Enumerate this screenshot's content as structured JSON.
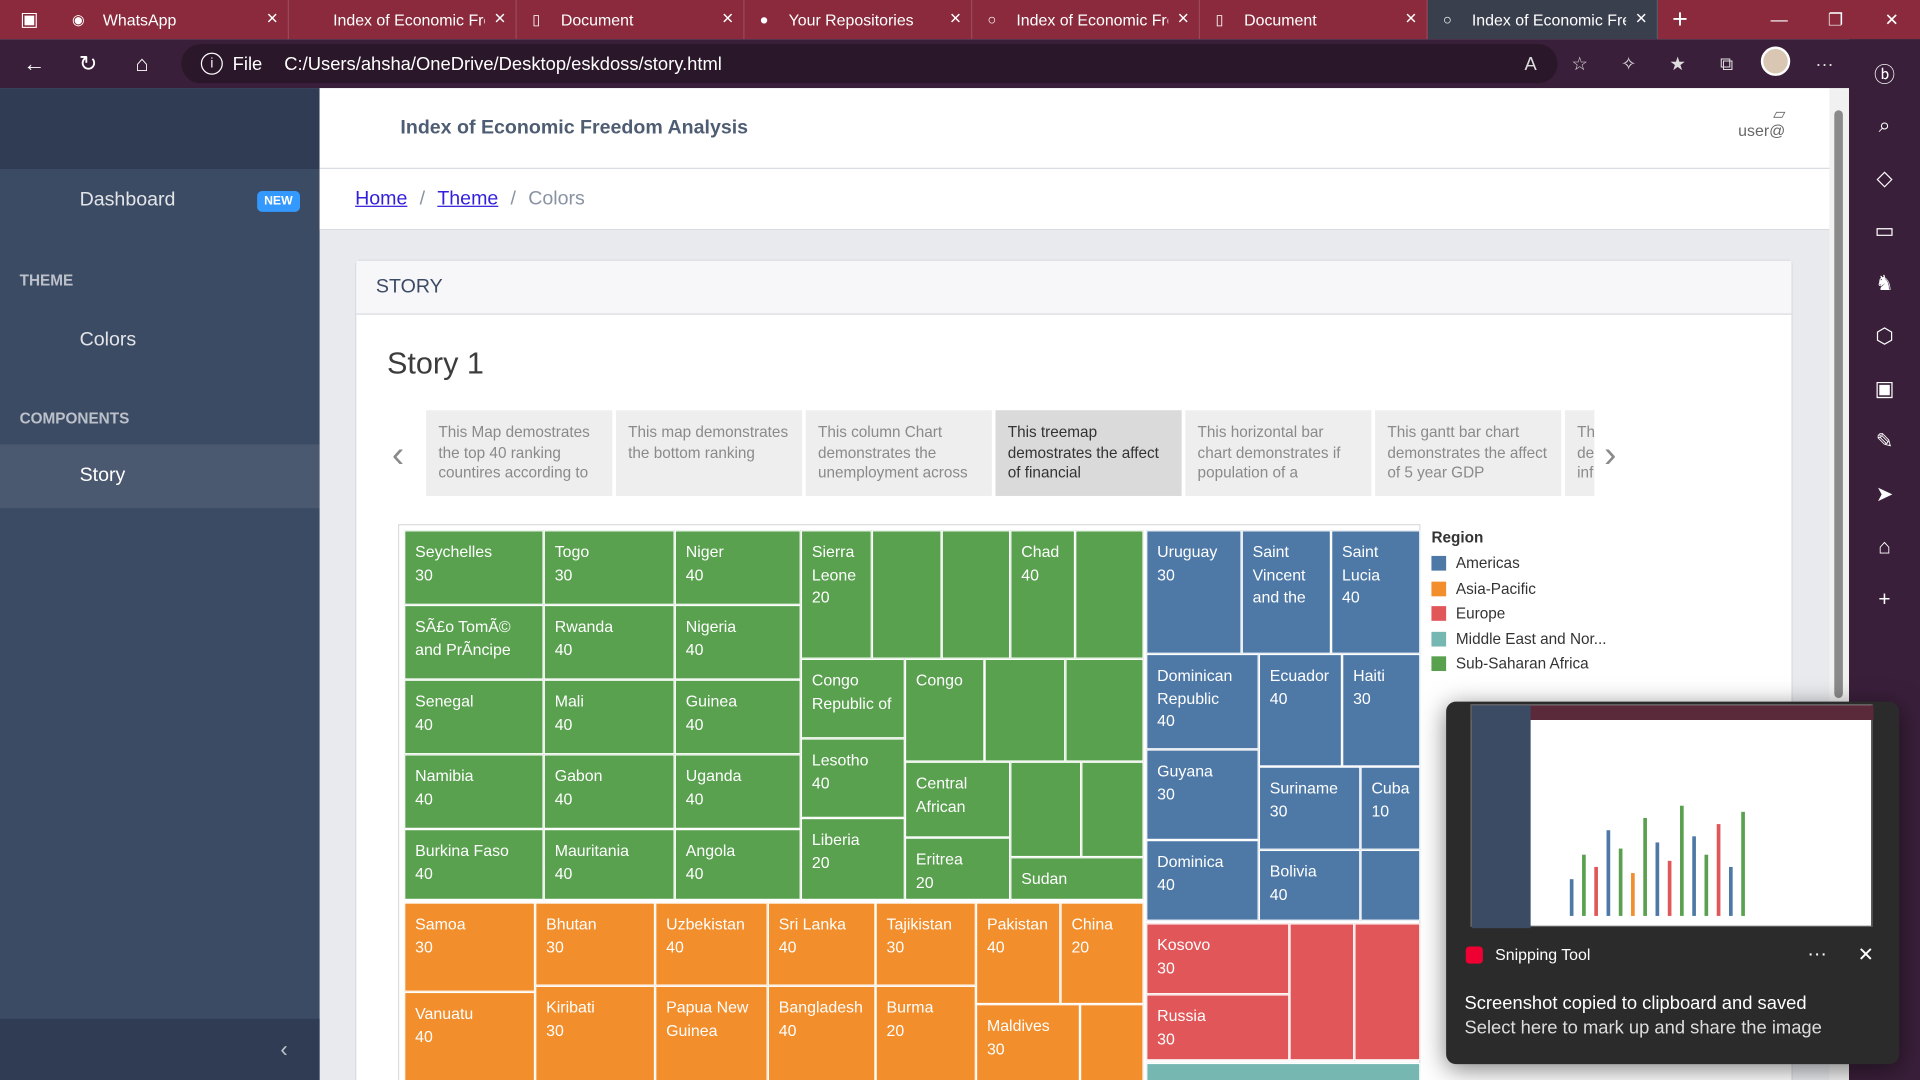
{
  "browser": {
    "tabs": [
      {
        "label": "WhatsApp",
        "icon": "whatsapp-icon"
      },
      {
        "label": "Index of Economic Fre",
        "icon": "page-icon"
      },
      {
        "label": "Document",
        "icon": "document-icon"
      },
      {
        "label": "Your Repositories",
        "icon": "github-icon"
      },
      {
        "label": "Index of Economic Fre",
        "icon": "page-icon"
      },
      {
        "label": "Document",
        "icon": "document-icon"
      },
      {
        "label": "Index of Economic Fre",
        "icon": "page-icon"
      }
    ],
    "address": {
      "scheme_label": "File",
      "url": "C:/Users/ahsha/OneDrive/Desktop/eskdoss/story.html"
    }
  },
  "sidebar": {
    "dashboard": "Dashboard",
    "dashboard_badge": "NEW",
    "section_theme": "THEME",
    "colors": "Colors",
    "section_components": "COMPONENTS",
    "story": "Story",
    "collapse_icon": "chevron-left-icon"
  },
  "header": {
    "title": "Index of Economic Freedom Analysis",
    "user_alt": "user@"
  },
  "breadcrumb": {
    "home": "Home",
    "theme": "Theme",
    "current": "Colors"
  },
  "card": {
    "header": "STORY",
    "story_title": "Story 1"
  },
  "story_points": [
    "This Map demostrates the top 40 ranking countires according to",
    "This map demonstrates the bottom ranking",
    "This column Chart demonstrates the unemployment across",
    "This treemap demostrates the affect of financial",
    "This horizontal bar chart demonstrates if population of a",
    "This gantt bar chart demonstrates the affect of 5 year GDP",
    "This des inf"
  ],
  "treemap": {
    "cells": [
      {
        "name": "Seychelles",
        "value": "30"
      },
      {
        "name": "Togo",
        "value": "30"
      },
      {
        "name": "Niger",
        "value": "40"
      },
      {
        "name": "Sierra Leone",
        "value": "20"
      },
      {
        "name": "Chad",
        "value": "40"
      },
      {
        "name": "SÃ£o TomÃ© and PrÃncipe",
        "value": ""
      },
      {
        "name": "Rwanda",
        "value": "40"
      },
      {
        "name": "Nigeria",
        "value": "40"
      },
      {
        "name": "Congo Republic of",
        "value": ""
      },
      {
        "name": "Congo",
        "value": ""
      },
      {
        "name": "Senegal",
        "value": "40"
      },
      {
        "name": "Mali",
        "value": "40"
      },
      {
        "name": "Guinea",
        "value": "40"
      },
      {
        "name": "Lesotho",
        "value": "40"
      },
      {
        "name": "Central African",
        "value": ""
      },
      {
        "name": "Namibia",
        "value": "40"
      },
      {
        "name": "Gabon",
        "value": "40"
      },
      {
        "name": "Uganda",
        "value": "40"
      },
      {
        "name": "Liberia",
        "value": "20"
      },
      {
        "name": "Eritrea",
        "value": "20"
      },
      {
        "name": "Burkina Faso",
        "value": "40"
      },
      {
        "name": "Mauritania",
        "value": "40"
      },
      {
        "name": "Angola",
        "value": "40"
      },
      {
        "name": "Sudan",
        "value": ""
      },
      {
        "name": "Uruguay",
        "value": "30"
      },
      {
        "name": "Saint Vincent and the",
        "value": ""
      },
      {
        "name": "Saint Lucia",
        "value": "40"
      },
      {
        "name": "Dominican Republic",
        "value": "40"
      },
      {
        "name": "Ecuador",
        "value": "40"
      },
      {
        "name": "Haiti",
        "value": "30"
      },
      {
        "name": "Guyana",
        "value": "30"
      },
      {
        "name": "Suriname",
        "value": "30"
      },
      {
        "name": "Cuba",
        "value": "10"
      },
      {
        "name": "Dominica",
        "value": "40"
      },
      {
        "name": "Bolivia",
        "value": "40"
      },
      {
        "name": "Samoa",
        "value": "30"
      },
      {
        "name": "Bhutan",
        "value": "30"
      },
      {
        "name": "Uzbekistan",
        "value": "40"
      },
      {
        "name": "Sri Lanka",
        "value": "40"
      },
      {
        "name": "Tajikistan",
        "value": "30"
      },
      {
        "name": "Pakistan",
        "value": "40"
      },
      {
        "name": "China",
        "value": "20"
      },
      {
        "name": "Vanuatu",
        "value": "40"
      },
      {
        "name": "Kiribati",
        "value": "30"
      },
      {
        "name": "Papua New Guinea",
        "value": ""
      },
      {
        "name": "Bangladesh",
        "value": "40"
      },
      {
        "name": "Burma",
        "value": "20"
      },
      {
        "name": "Maldives",
        "value": "30"
      },
      {
        "name": "Kosovo",
        "value": "30"
      },
      {
        "name": "Russia",
        "value": "30"
      }
    ]
  },
  "legend": {
    "title": "Region",
    "items": [
      {
        "label": "Americas",
        "color": "#4e79a7"
      },
      {
        "label": "Asia-Pacific",
        "color": "#f28e2b"
      },
      {
        "label": "Europe",
        "color": "#e15759"
      },
      {
        "label": "Middle East and Nor...",
        "color": "#76b7b2"
      },
      {
        "label": "Sub-Saharan Africa",
        "color": "#59a14f"
      }
    ]
  },
  "toast": {
    "app": "Snipping Tool",
    "more": "···",
    "title": "Screenshot copied to clipboard and saved",
    "subtitle": "Select here to mark up and share the image"
  }
}
